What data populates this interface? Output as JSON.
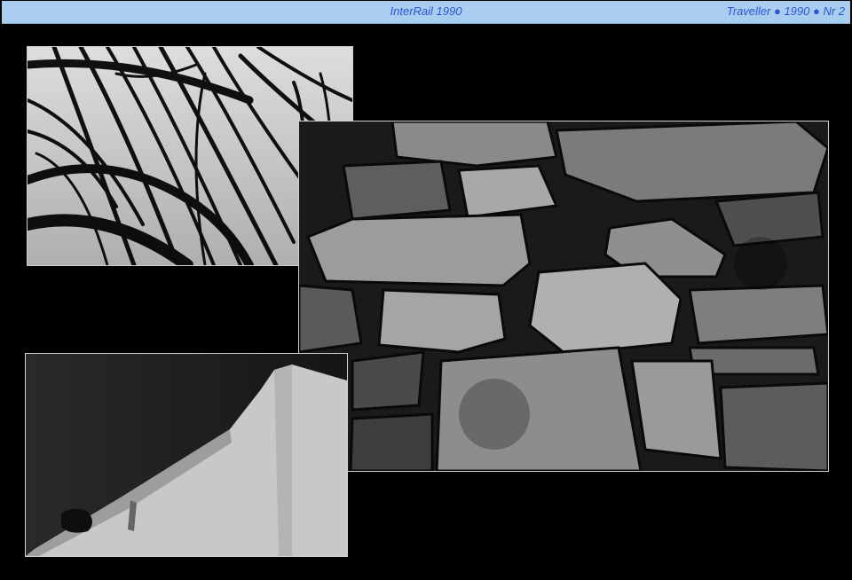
{
  "header": {
    "title": "InterRail 1990",
    "issue": "Traveller ● 1990 ● Nr 2"
  },
  "colors": {
    "header_bg": "#a9cdee",
    "header_text": "#2b55d6",
    "page_bg": "#000000"
  },
  "photos": [
    "palm-fronds-photo",
    "stone-wall-photo",
    "whitewashed-wall-photo"
  ]
}
